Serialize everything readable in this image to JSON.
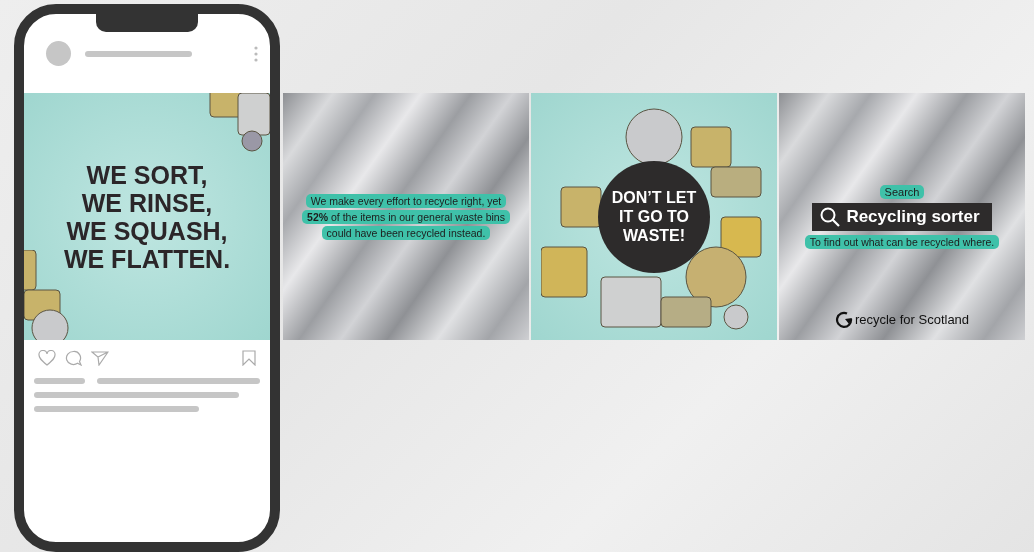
{
  "slides": [
    {
      "kind": "headline",
      "lines": [
        "WE SORT,",
        "WE RINSE,",
        "WE SQUASH,",
        "WE FLATTEN."
      ]
    },
    {
      "kind": "stat",
      "lines": [
        "We make every effort to recycle right, yet",
        "**52%** of the items in our general waste bins",
        "could have been recycled instead."
      ]
    },
    {
      "kind": "badge",
      "lines": [
        "DON’T LET",
        "IT GO TO",
        "WASTE!"
      ]
    },
    {
      "kind": "search",
      "label": "Search",
      "query": "Recycling sorter",
      "caption": "To find out what can be recycled where.",
      "logo": "recycle for Scotland"
    }
  ]
}
